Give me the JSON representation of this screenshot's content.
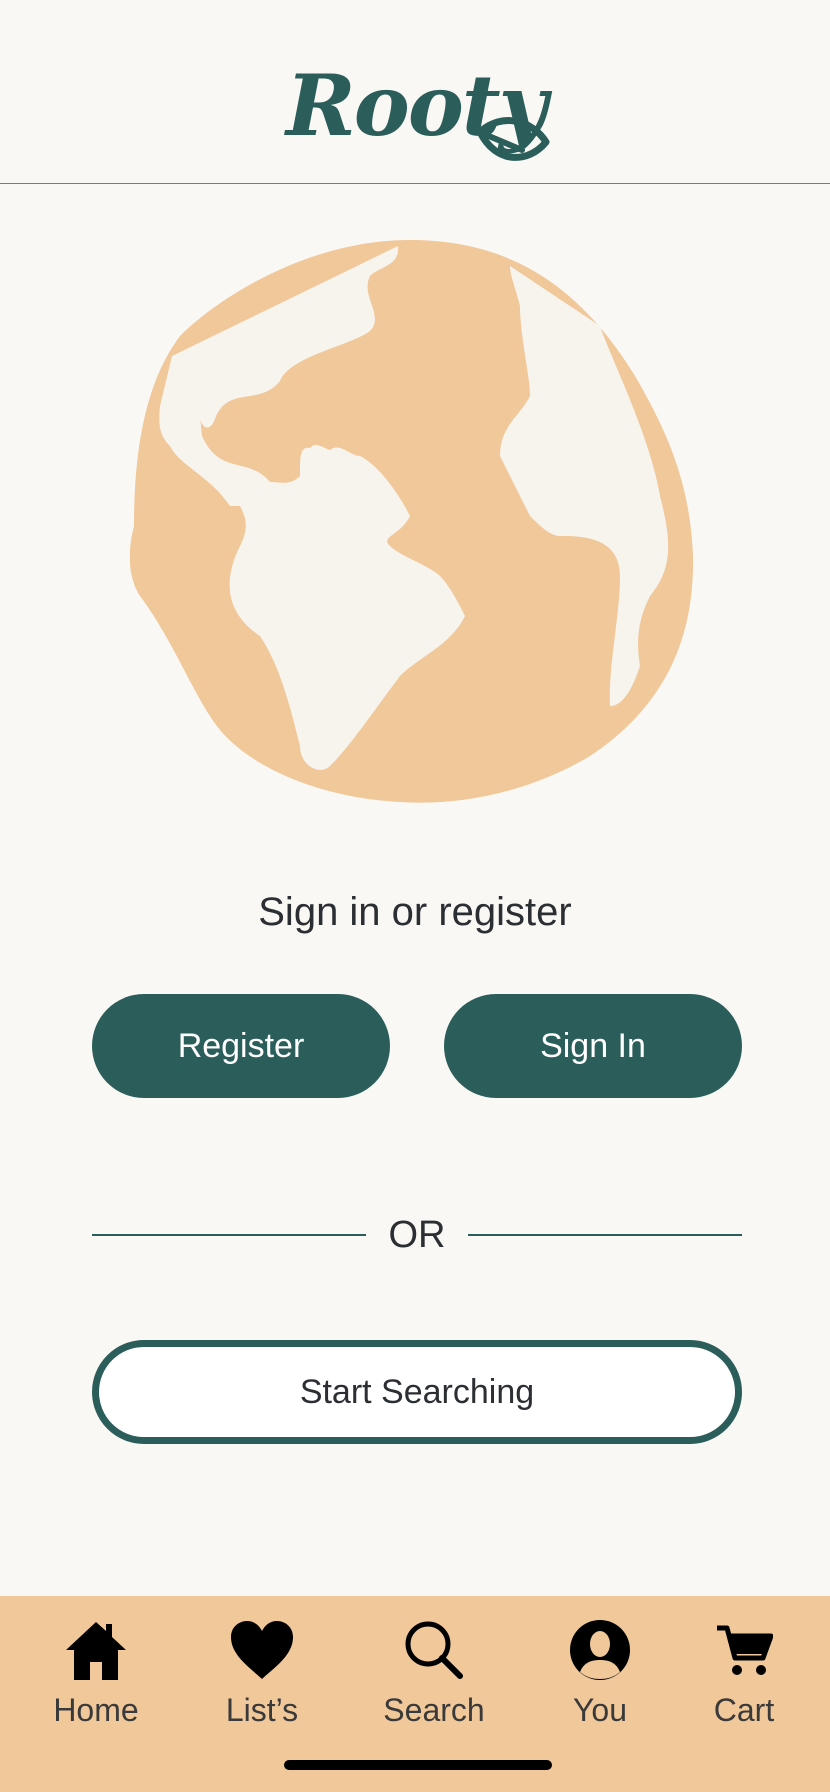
{
  "app": {
    "name": "Rooty"
  },
  "auth": {
    "prompt": "Sign in or register",
    "register_label": "Register",
    "signin_label": "Sign In",
    "divider_text": "OR",
    "search_label": "Start Searching"
  },
  "tabbar": {
    "items": [
      {
        "label": "Home",
        "icon": "home-icon"
      },
      {
        "label": "List’s",
        "icon": "heart-icon"
      },
      {
        "label": "Search",
        "icon": "search-icon"
      },
      {
        "label": "You",
        "icon": "user-icon"
      },
      {
        "label": "Cart",
        "icon": "cart-icon"
      }
    ]
  },
  "colors": {
    "brand": "#2b5e5b",
    "globe": "#f0c89a",
    "background": "#faf8f4",
    "tabbar": "#f0c89a"
  }
}
